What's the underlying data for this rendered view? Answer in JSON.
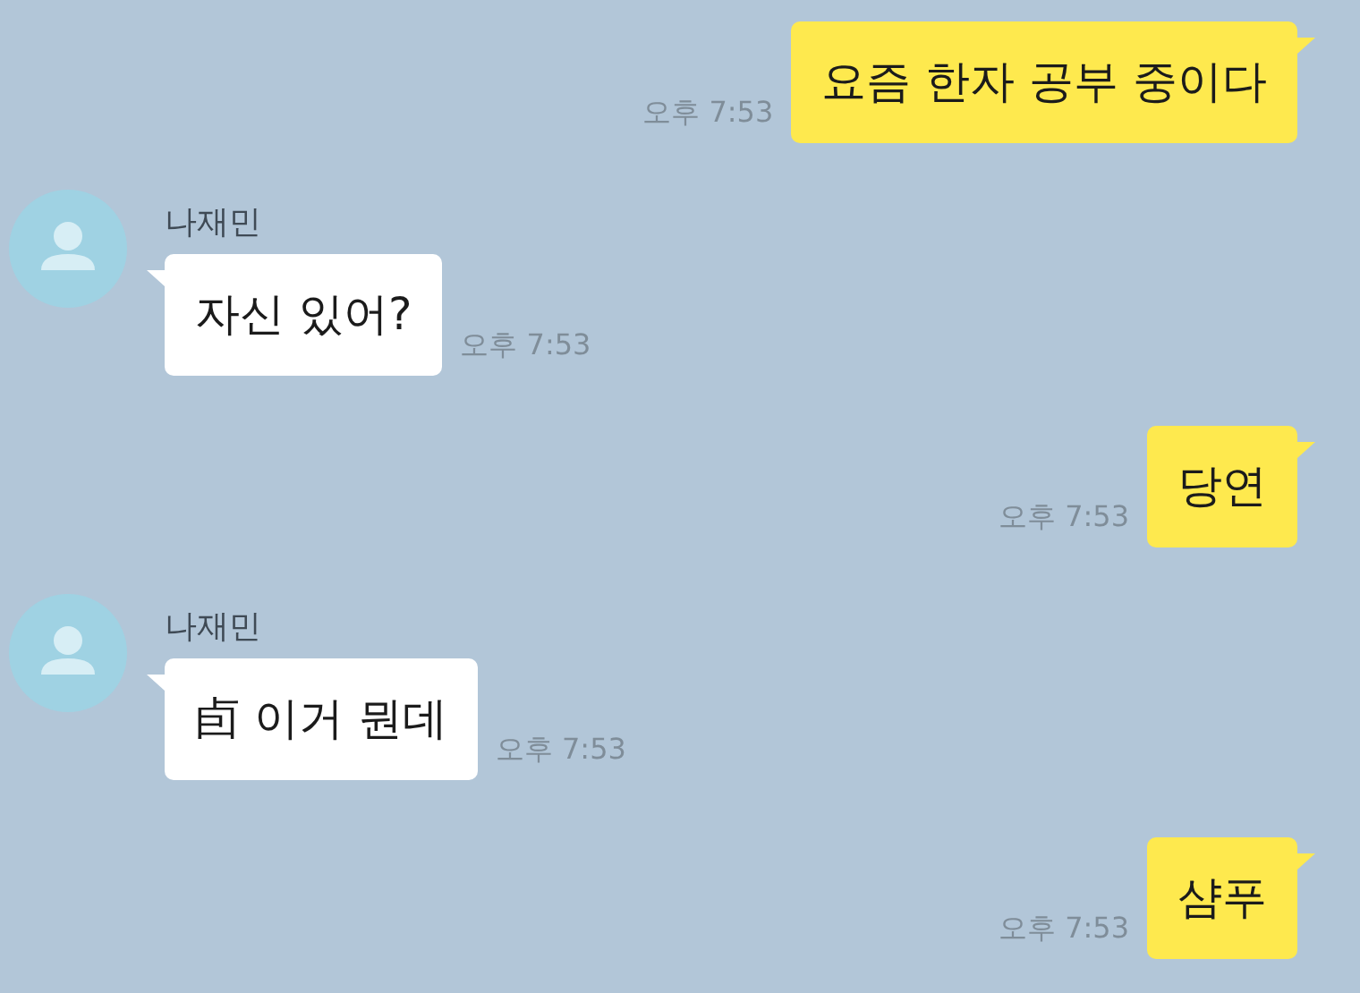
{
  "messages": [
    {
      "kind": "sent",
      "text": "요즘 한자 공부 중이다",
      "time": "오후 7:53"
    },
    {
      "kind": "received",
      "sender": "나재민",
      "text": "자신 있어?",
      "time": "오후 7:53"
    },
    {
      "kind": "sent",
      "text": "당연",
      "time": "오후 7:53"
    },
    {
      "kind": "received",
      "sender": "나재민",
      "text": "卣 이거 뭔데",
      "time": "오후 7:53"
    },
    {
      "kind": "sent",
      "text": "샴푸",
      "time": "오후 7:53"
    }
  ]
}
